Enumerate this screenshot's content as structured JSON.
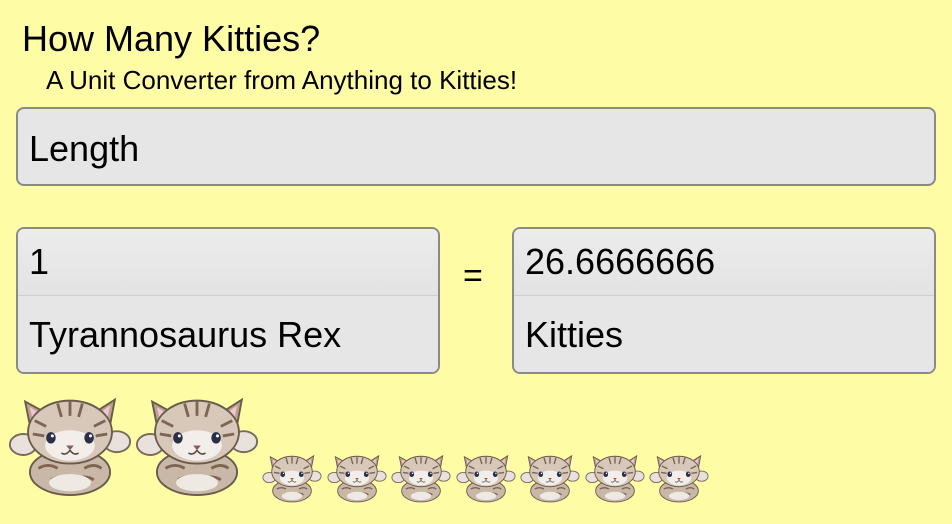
{
  "header": {
    "title": "How Many Kitties?",
    "subtitle": "A Unit Converter from Anything to Kitties!"
  },
  "category": {
    "selected": "Length"
  },
  "converter": {
    "from_value": "1",
    "from_unit": "Tyrannosaurus Rex",
    "equals": "=",
    "to_value": "26.6666666",
    "to_unit": "Kitties"
  },
  "kitty_display": {
    "whole_kitties_large": 2,
    "small_kitties": 7,
    "icon": "kitty-icon"
  },
  "colors": {
    "background": "#fffca6",
    "box_fill": "#e6e6e6",
    "box_border": "#8a8a8a"
  }
}
